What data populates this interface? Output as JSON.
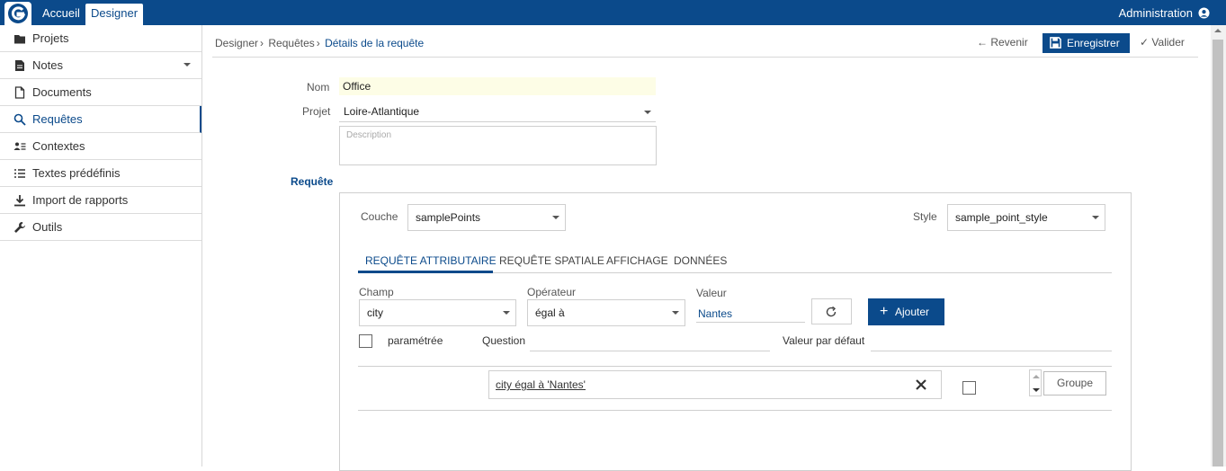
{
  "topbar": {
    "nav": [
      "Accueil",
      "Designer"
    ],
    "admin_label": "Administration"
  },
  "sidebar": {
    "items": [
      {
        "label": "Projets",
        "icon": "folder-icon"
      },
      {
        "label": "Notes",
        "icon": "note-icon"
      },
      {
        "label": "Documents",
        "icon": "document-icon"
      },
      {
        "label": "Requêtes",
        "icon": "search-icon"
      },
      {
        "label": "Contextes",
        "icon": "contexts-icon"
      },
      {
        "label": "Textes prédéfinis",
        "icon": "list-icon"
      },
      {
        "label": "Import de rapports",
        "icon": "download-icon"
      },
      {
        "label": "Outils",
        "icon": "wrench-icon"
      }
    ]
  },
  "breadcrumb": {
    "items": [
      "Designer",
      "Requêtes",
      "Détails de la requête"
    ]
  },
  "toolbar": {
    "back": "Revenir",
    "save": "Enregistrer",
    "validate": "Valider"
  },
  "form": {
    "name_label": "Nom",
    "name_value": "Office",
    "project_label": "Projet",
    "project_value": "Loire-Atlantique",
    "description_placeholder": "Description"
  },
  "query": {
    "section_title": "Requête",
    "layer_label": "Couche",
    "layer_value": "samplePoints",
    "style_label": "Style",
    "style_value": "sample_point_style",
    "tabs": [
      "REQUÊTE ATTRIBUTAIRE",
      "REQUÊTE SPATIALE",
      "AFFICHAGE",
      "DONNÉES"
    ],
    "field_label": "Champ",
    "field_value": "city",
    "operator_label": "Opérateur",
    "operator_value": "égal à",
    "value_label": "Valeur",
    "value_value": "Nantes",
    "add_label": "Ajouter",
    "param_label": "paramétrée",
    "question_label": "Question",
    "default_label": "Valeur par défaut",
    "condition_text": "city égal à 'Nantes'",
    "group_label": "Groupe"
  },
  "colors": {
    "primary": "#0b4a8b",
    "name_bg": "#fdfde6"
  }
}
